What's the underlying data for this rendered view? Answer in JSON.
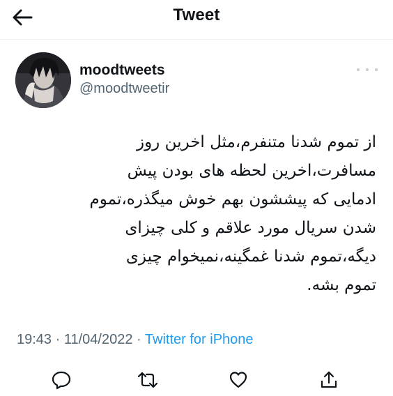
{
  "header": {
    "title": "Tweet",
    "back_icon": "arrow-left-icon"
  },
  "author": {
    "display_name": "moodtweets",
    "handle": "@moodtweetir",
    "avatar": "anime-character-avatar"
  },
  "tweet": {
    "text": "از تموم شدنا متنفرم،مثل اخرین روز\nمسافرت،اخرین لحظه های بودن پیش\nادمایی که پیششون بهم خوش میگذره،تموم\nشدن سریال مورد علاقم و کلی چیزای\nدیگه،تموم شدنا غمگینه،نمیخوام چیزی\nتموم بشه.",
    "time": "19:43",
    "separator": "·",
    "date": "11/04/2022",
    "source": "Twitter for iPhone"
  },
  "actions": {
    "reply_icon": "reply-icon",
    "retweet_icon": "retweet-icon",
    "like_icon": "heart-icon",
    "share_icon": "share-icon"
  },
  "colors": {
    "text": "#0f1419",
    "secondary": "#536471",
    "link": "#1d9bf0"
  }
}
